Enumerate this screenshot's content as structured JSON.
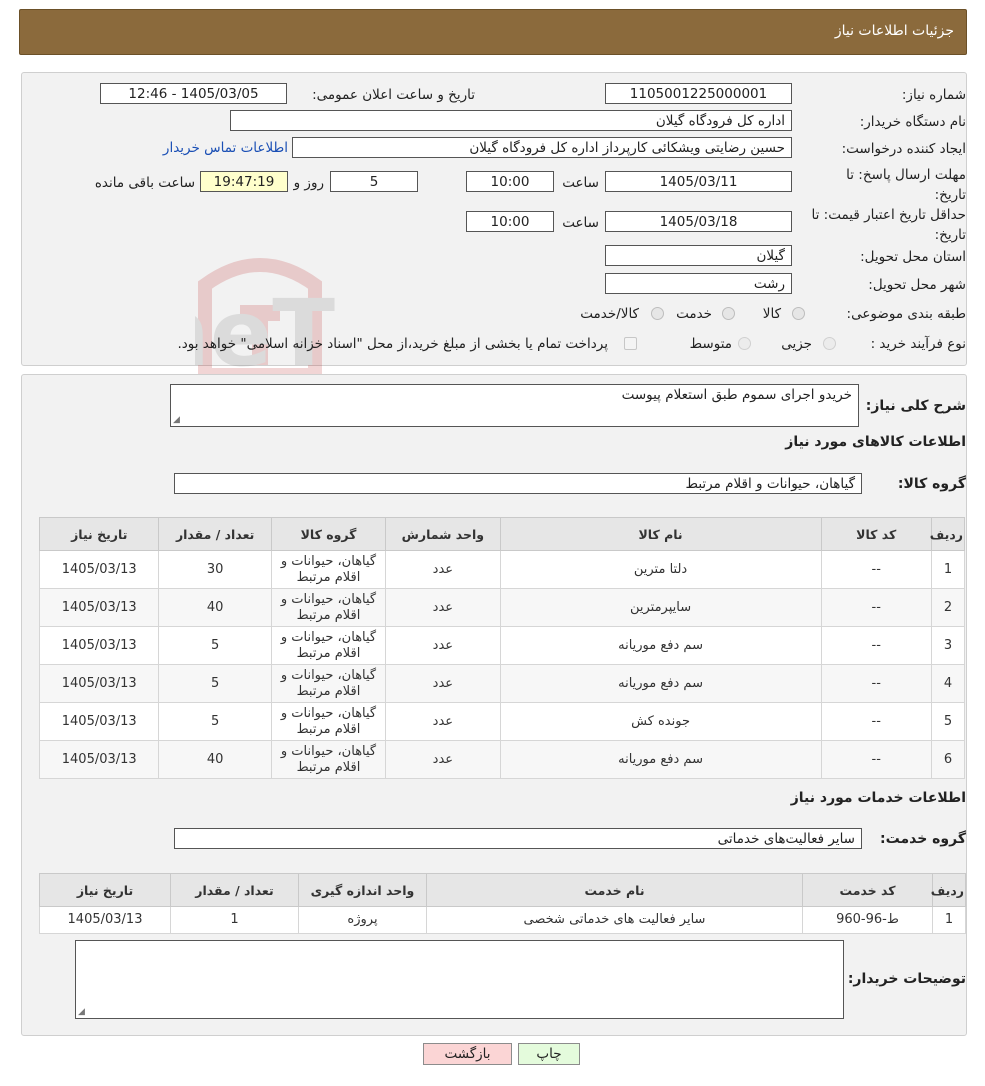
{
  "header": {
    "title": "جزئیات اطلاعات نیاز"
  },
  "info": {
    "need_number_label": "شماره نیاز:",
    "need_number": "1105001225000001",
    "announce_label": "تاریخ و ساعت اعلان عمومی:",
    "announce_value": "1405/03/05 - 12:46",
    "buyer_org_label": "نام دستگاه خریدار:",
    "buyer_org": "اداره کل فرودگاه گیلان",
    "requester_label": "ایجاد کننده درخواست:",
    "requester": "حسین رضایتی ویشکائی کارپرداز اداره کل فرودگاه گیلان",
    "contact_link": "اطلاعات تماس خریدار",
    "deadline_label": "مهلت ارسال پاسخ: تا تاریخ:",
    "deadline_date": "1405/03/11",
    "time_label": "ساعت",
    "deadline_time": "10:00",
    "remaining_days": "5",
    "days_label": "روز و",
    "remaining_time": "19:47:19",
    "remaining_label": "ساعت باقی مانده",
    "validity_label": "حداقل تاریخ اعتبار قیمت: تا تاریخ:",
    "validity_date": "1405/03/18",
    "validity_time": "10:00",
    "province_label": "استان محل تحویل:",
    "province": "گیلان",
    "city_label": "شهر محل تحویل:",
    "city": "رشت",
    "category_label": "طبقه بندی موضوعی:",
    "category_options": [
      "کالا",
      "خدمت",
      "کالا/خدمت"
    ],
    "process_label": "نوع فرآیند خرید :",
    "process_options": [
      "جزیی",
      "متوسط"
    ],
    "process_note": "پرداخت تمام یا بخشی از مبلغ خرید،از محل \"اسناد خزانه اسلامی\" خواهد بود."
  },
  "desc": {
    "summary_label": "شرح کلی نیاز:",
    "summary": "خریدو اجرای سموم طبق استعلام پیوست",
    "goods_title": "اطلاعات کالاهای مورد نیاز",
    "goods_group_label": "گروه کالا:",
    "goods_group": "گیاهان، حیوانات و اقلام مرتبط",
    "goods_headers": [
      "ردیف",
      "کد کالا",
      "نام کالا",
      "واحد شمارش",
      "گروه کالا",
      "تعداد / مقدار",
      "تاریخ نیاز"
    ],
    "goods_rows": [
      [
        "1",
        "--",
        "دلتا مترین",
        "عدد",
        "گیاهان، حیوانات و اقلام مرتبط",
        "30",
        "1405/03/13"
      ],
      [
        "2",
        "--",
        "سایپرمترین",
        "عدد",
        "گیاهان، حیوانات و اقلام مرتبط",
        "40",
        "1405/03/13"
      ],
      [
        "3",
        "--",
        "سم دفع موریانه",
        "عدد",
        "گیاهان، حیوانات و اقلام مرتبط",
        "5",
        "1405/03/13"
      ],
      [
        "4",
        "--",
        "سم دفع موریانه",
        "عدد",
        "گیاهان، حیوانات و اقلام مرتبط",
        "5",
        "1405/03/13"
      ],
      [
        "5",
        "--",
        "جونده کش",
        "عدد",
        "گیاهان، حیوانات و اقلام مرتبط",
        "5",
        "1405/03/13"
      ],
      [
        "6",
        "--",
        "سم دفع موریانه",
        "عدد",
        "گیاهان، حیوانات و اقلام مرتبط",
        "40",
        "1405/03/13"
      ]
    ],
    "services_title": "اطلاعات خدمات مورد نیاز",
    "service_group_label": "گروه خدمت:",
    "service_group": "سایر فعالیت‌های خدماتی",
    "service_headers": [
      "ردیف",
      "کد خدمت",
      "نام خدمت",
      "واحد اندازه گیری",
      "تعداد / مقدار",
      "تاریخ نیاز"
    ],
    "service_rows": [
      [
        "1",
        "ط-96-960",
        "سایر فعالیت های خدماتی شخصی",
        "پروژه",
        "1",
        "1405/03/13"
      ]
    ],
    "buyer_notes_label": "توضیحات خریدار:",
    "buyer_notes": ""
  },
  "buttons": {
    "print": "چاپ",
    "back": "بازگشت"
  },
  "watermark": {
    "text": "AriaTender.neT"
  },
  "colors": {
    "header_bg": "#8b6a3c",
    "link": "#1a4fb5",
    "countdown_bg": "#ffffcc",
    "print_btn": "#e4fbdc",
    "back_btn": "#fbd5d5"
  }
}
